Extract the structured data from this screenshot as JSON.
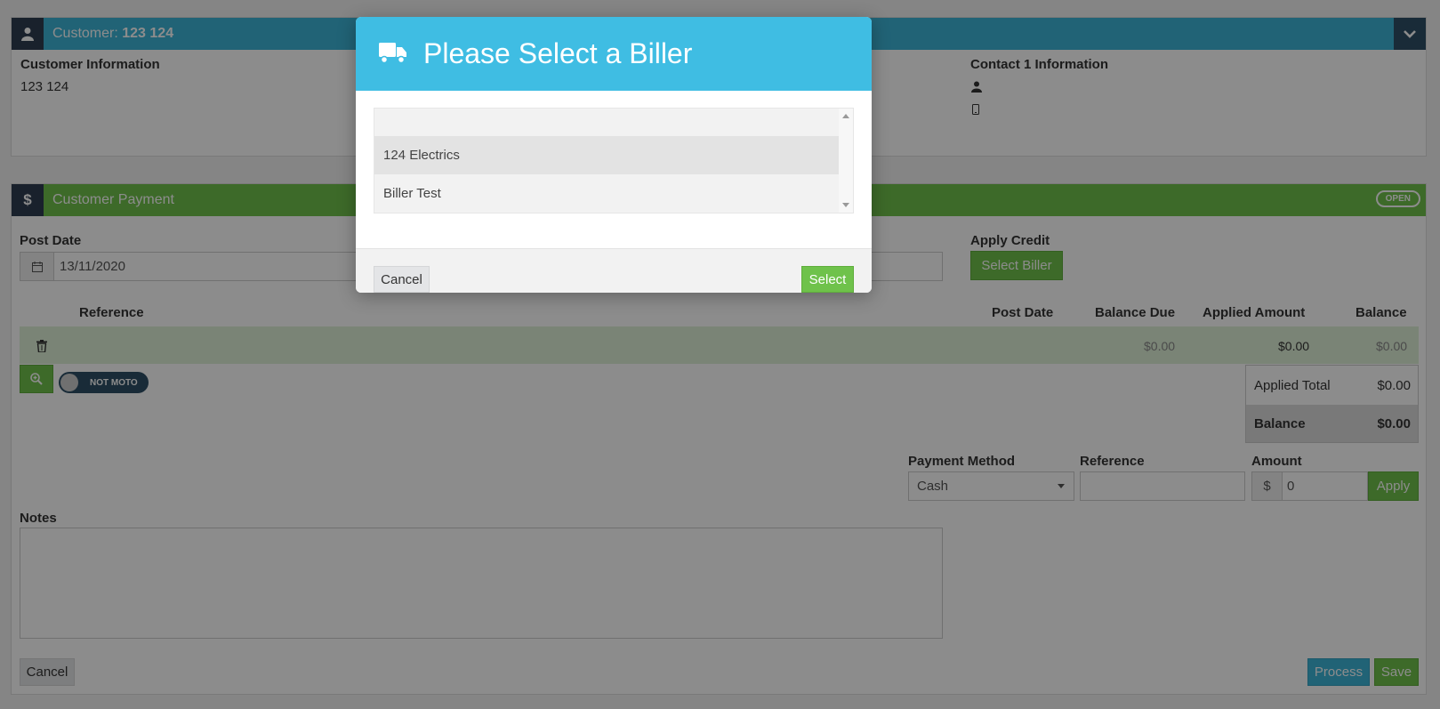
{
  "customer": {
    "header_prefix": "Customer:",
    "header_name": "123 124",
    "info_title": "Customer Information",
    "info_name": "123 124",
    "contact_title": "Contact 1 Information"
  },
  "payment": {
    "header_title": "Customer Payment",
    "status_badge": "OPEN",
    "post_date_label": "Post Date",
    "post_date_value": "13/11/2020",
    "apply_credit_label": "Apply Credit",
    "select_biller_label": "Select Biller",
    "table": {
      "headers": [
        "Reference",
        "Post Date",
        "Balance Due",
        "Applied Amount",
        "Balance"
      ],
      "row": {
        "balance_due": "$0.00",
        "applied_amount": "$0.00",
        "balance": "$0.00"
      }
    },
    "moto_toggle": "NOT MOTO",
    "applied_total_label": "Applied Total",
    "applied_total_value": "$0.00",
    "balance_label": "Balance",
    "balance_value": "$0.00",
    "payment_method_label": "Payment Method",
    "payment_method_value": "Cash",
    "reference_label": "Reference",
    "amount_label": "Amount",
    "amount_prefix": "$",
    "amount_value": "0",
    "apply_label": "Apply",
    "notes_label": "Notes",
    "cancel_label": "Cancel",
    "process_label": "Process",
    "save_label": "Save"
  },
  "modal": {
    "title": "Please Select a Biller",
    "options": [
      "124 Electrics",
      "Biller Test"
    ],
    "cancel_label": "Cancel",
    "select_label": "Select"
  },
  "colors": {
    "primary_blue": "#3db5d8",
    "primary_green": "#6fc24b",
    "dark_navy": "#2f3d50"
  }
}
